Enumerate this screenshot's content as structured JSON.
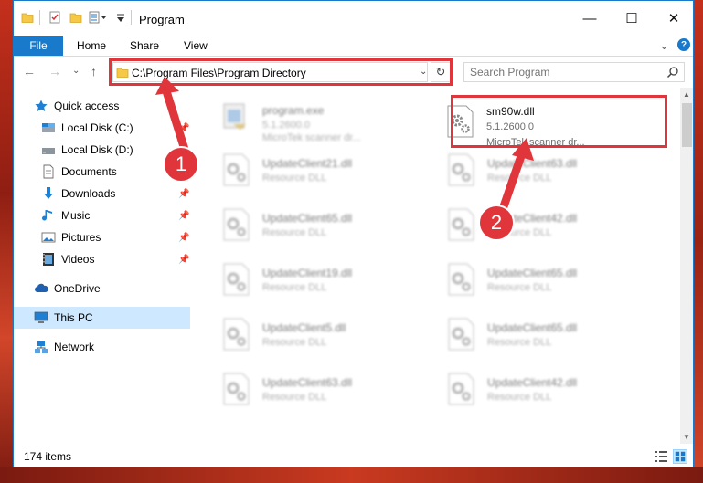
{
  "window": {
    "title": "Program",
    "minimize": "—",
    "maximize": "☐",
    "close": "✕"
  },
  "ribbon": {
    "file": "File",
    "tabs": [
      "Home",
      "Share",
      "View"
    ],
    "expand": "⌄",
    "help": "?"
  },
  "nav": {
    "back": "←",
    "forward": "→",
    "recent": "⌄",
    "up": "↑",
    "address": "C:\\Program Files\\Program Directory",
    "address_dropdown": "⌄",
    "refresh": "↻",
    "search_placeholder": "Search Program"
  },
  "sidebar": {
    "items": [
      {
        "label": "Quick access",
        "icon": "star-icon",
        "pinned": false
      },
      {
        "label": "Local Disk (C:)",
        "icon": "drive-icon",
        "pinned": true
      },
      {
        "label": "Local Disk (D:)",
        "icon": "drive-icon",
        "pinned": false
      },
      {
        "label": "Documents",
        "icon": "documents-icon",
        "pinned": true
      },
      {
        "label": "Downloads",
        "icon": "download-icon",
        "pinned": true
      },
      {
        "label": "Music",
        "icon": "music-icon",
        "pinned": true
      },
      {
        "label": "Pictures",
        "icon": "pictures-icon",
        "pinned": true
      },
      {
        "label": "Videos",
        "icon": "videos-icon",
        "pinned": true
      },
      {
        "label": "OneDrive",
        "icon": "cloud-icon",
        "pinned": false
      },
      {
        "label": "This PC",
        "icon": "computer-icon",
        "pinned": false,
        "selected": true
      },
      {
        "label": "Network",
        "icon": "network-icon",
        "pinned": false
      }
    ],
    "pin_glyph": "📌"
  },
  "files": {
    "highlighted": {
      "name": "sm90w.dll",
      "version": "5.1.2600.0",
      "description": "MicroTek scanner dr..."
    },
    "top_left": {
      "name": "program.exe",
      "version": "5.1.2600.0",
      "description": "MicroTek scanner dr..."
    },
    "left": [
      {
        "name": "UpdateClient21.dll",
        "type": "Resource DLL"
      },
      {
        "name": "UpdateClient65.dll",
        "type": "Resource DLL"
      },
      {
        "name": "UpdateClient19.dll",
        "type": "Resource DLL"
      },
      {
        "name": "UpdateClient5.dll",
        "type": "Resource DLL"
      },
      {
        "name": "UpdateClient63.dll",
        "type": "Resource DLL"
      }
    ],
    "right": [
      {
        "name": "UpdateClient63.dll",
        "type": "Resource DLL"
      },
      {
        "name": "UpdateClient42.dll",
        "type": "Resource DLL"
      },
      {
        "name": "UpdateClient65.dll",
        "type": "Resource DLL"
      },
      {
        "name": "UpdateClient65.dll",
        "type": "Resource DLL"
      },
      {
        "name": "UpdateClient42.dll",
        "type": "Resource DLL"
      }
    ]
  },
  "status": {
    "items": "174 items"
  },
  "annotations": {
    "step1": "1",
    "step2": "2"
  },
  "colors": {
    "accent": "#1979ca",
    "highlight": "#e0353b",
    "selected": "#cde8ff"
  }
}
